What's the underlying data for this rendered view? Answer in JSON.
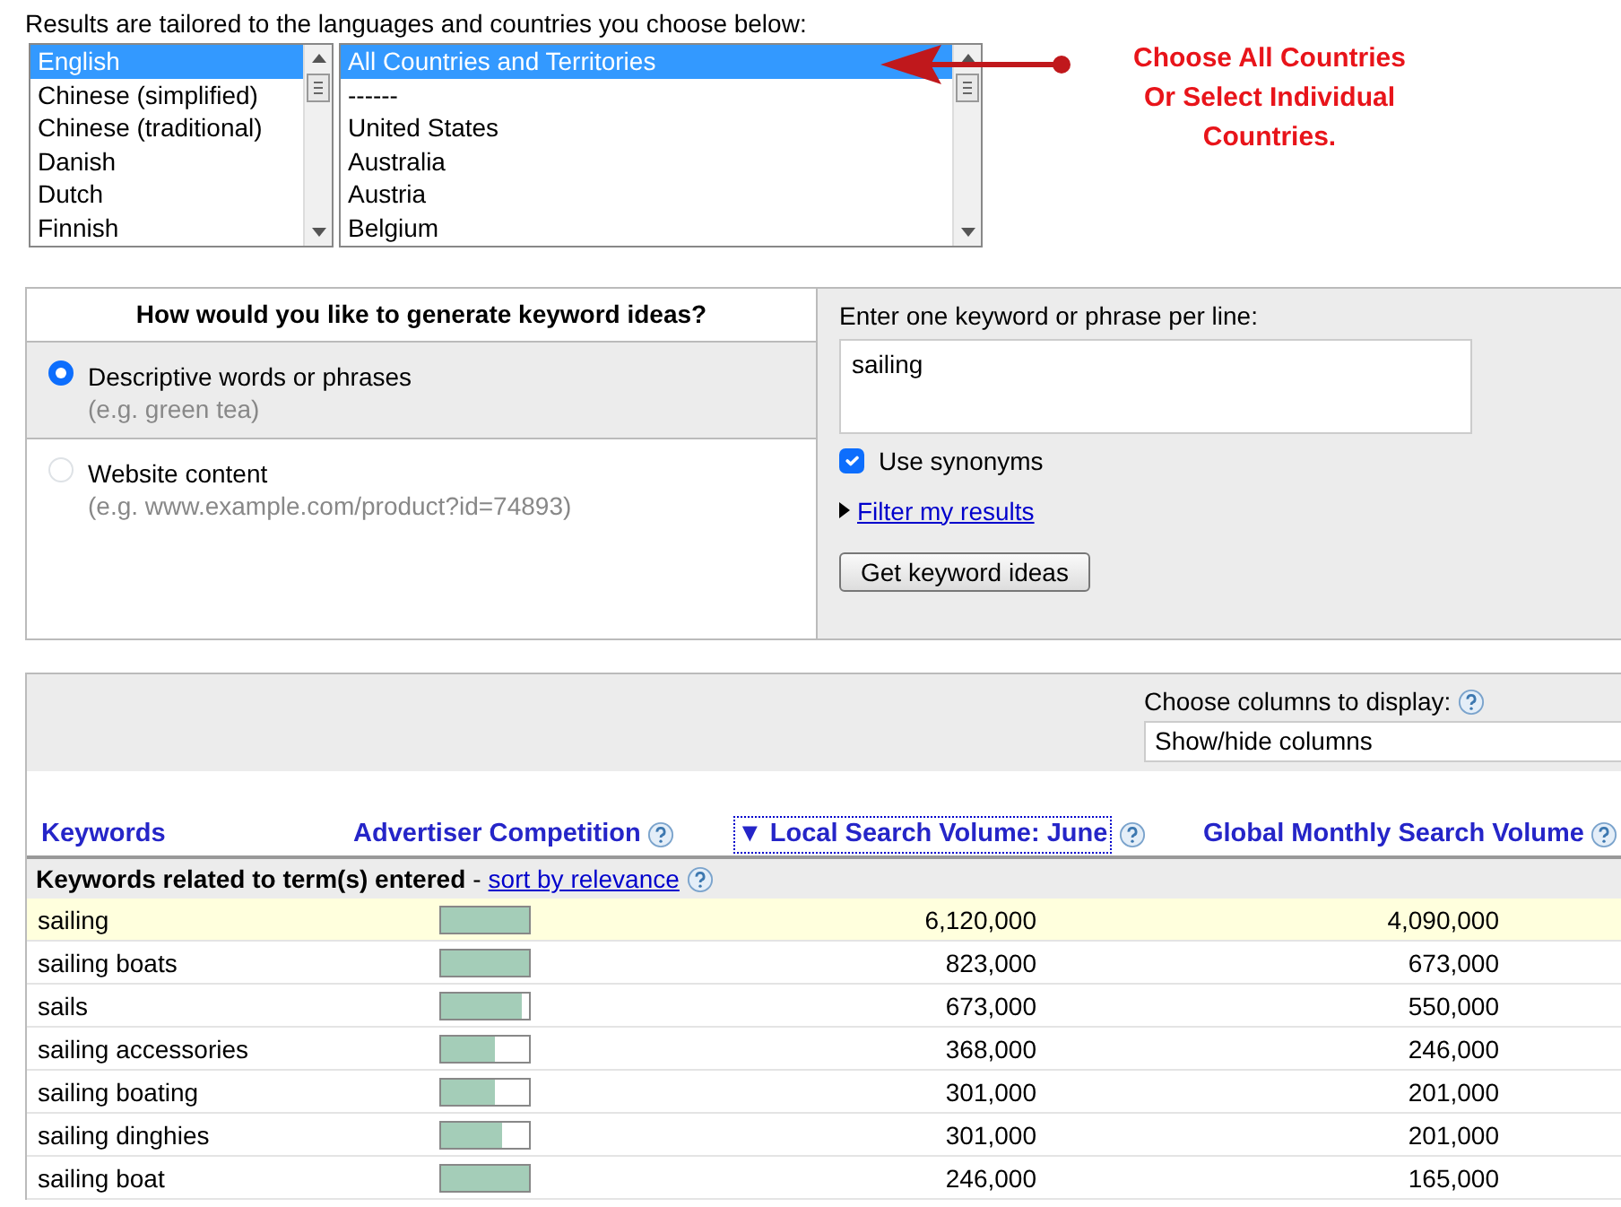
{
  "intro": "Results are tailored to the languages and countries you choose below:",
  "languages": [
    {
      "label": "English",
      "selected": true
    },
    {
      "label": "Chinese (simplified)",
      "selected": false
    },
    {
      "label": "Chinese (traditional)",
      "selected": false
    },
    {
      "label": "Danish",
      "selected": false
    },
    {
      "label": "Dutch",
      "selected": false
    },
    {
      "label": "Finnish",
      "selected": false
    }
  ],
  "countries": [
    {
      "label": "All Countries and Territories",
      "selected": true
    },
    {
      "label": "------",
      "selected": false
    },
    {
      "label": "United States",
      "selected": false
    },
    {
      "label": "Australia",
      "selected": false
    },
    {
      "label": "Austria",
      "selected": false
    },
    {
      "label": "Belgium",
      "selected": false
    }
  ],
  "annotation": {
    "lines": [
      "Choose All Countries",
      "Or Select Individual",
      "Countries."
    ]
  },
  "generate": {
    "question": "How would you like to generate keyword ideas?",
    "options": [
      {
        "label": "Descriptive words or phrases",
        "hint": "(e.g. green tea)",
        "selected": true
      },
      {
        "label": "Website content",
        "hint": "(e.g. www.example.com/product?id=74893)",
        "selected": false
      }
    ],
    "keyword_label": "Enter one keyword or phrase per line:",
    "keyword_value": "sailing",
    "synonyms": {
      "label": "Use synonyms",
      "checked": true
    },
    "filter_link": "Filter my results",
    "button": "Get keyword ideas"
  },
  "results": {
    "columns_label": "Choose columns to display:",
    "columns_select": "Show/hide columns",
    "columns": [
      {
        "label": "Keywords",
        "help": false
      },
      {
        "label": "Advertiser Competition",
        "help": true
      },
      {
        "label": "Local Search Volume: June",
        "help": true,
        "sort_indicator": "▼"
      },
      {
        "label": "Global Monthly Search Volume",
        "help": true
      }
    ],
    "group": {
      "title": "Keywords related to term(s) entered",
      "separator": "-",
      "link": "sort by relevance"
    },
    "rows": [
      {
        "keyword": "sailing",
        "level": 1,
        "local": "6,120,000",
        "global": "4,090,000",
        "selected": true
      },
      {
        "keyword": "sailing boats",
        "level": 1,
        "local": "823,000",
        "global": "673,000",
        "selected": false
      },
      {
        "keyword": "sails",
        "level": 0.92,
        "local": "673,000",
        "global": "550,000",
        "selected": false
      },
      {
        "keyword": "sailing accessories",
        "level": 0.62,
        "local": "368,000",
        "global": "246,000",
        "selected": false
      },
      {
        "keyword": "sailing boating",
        "level": 0.62,
        "local": "301,000",
        "global": "201,000",
        "selected": false
      },
      {
        "keyword": "sailing dinghies",
        "level": 0.7,
        "local": "301,000",
        "global": "201,000",
        "selected": false
      },
      {
        "keyword": "sailing boat",
        "level": 1,
        "local": "246,000",
        "global": "165,000",
        "selected": false
      }
    ]
  }
}
